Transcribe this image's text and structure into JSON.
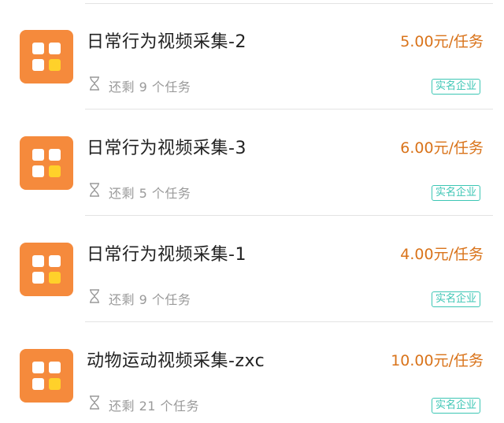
{
  "tasks": [
    {
      "title": "日常行为视频采集-2",
      "price": "5.00元/任务",
      "remaining": "还剩 9 个任务",
      "badge": "实名企业"
    },
    {
      "title": "日常行为视频采集-3",
      "price": "6.00元/任务",
      "remaining": "还剩 5 个任务",
      "badge": "实名企业"
    },
    {
      "title": "日常行为视频采集-1",
      "price": "4.00元/任务",
      "remaining": "还剩 9 个任务",
      "badge": "实名企业"
    },
    {
      "title": "动物运动视频采集-zxc",
      "price": "10.00元/任务",
      "remaining": "还剩 21 个任务",
      "badge": "实名企业"
    }
  ],
  "colors": {
    "icon_bg": "#f58a3c",
    "icon_accent": "#ffd12a",
    "price": "#d9731a",
    "badge": "#3cc6b4",
    "muted": "#9a9a9a"
  },
  "icons": {
    "task_icon": "app-grid-icon",
    "remaining_icon": "hourglass-icon"
  }
}
